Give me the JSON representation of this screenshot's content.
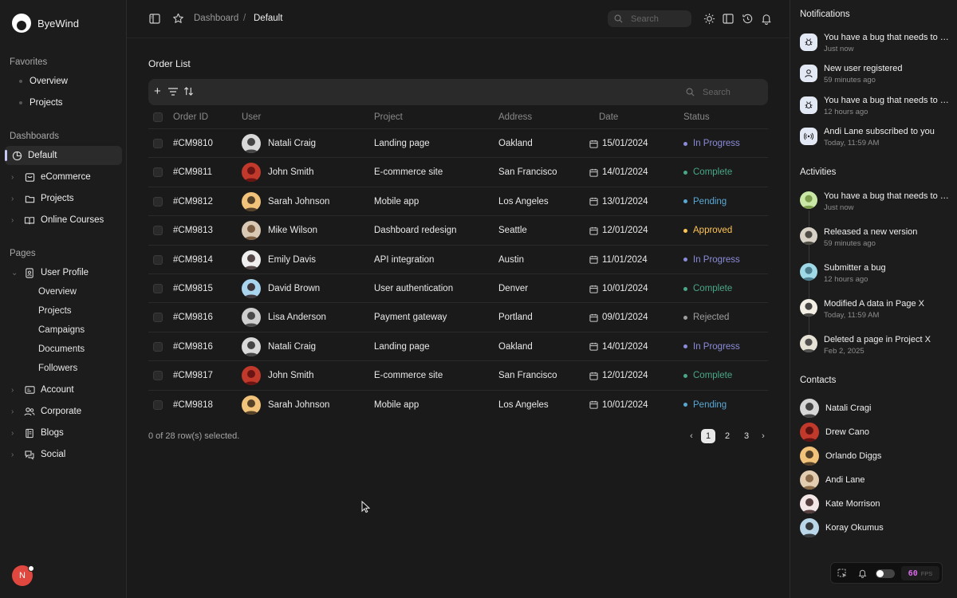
{
  "brand": {
    "name": "ByeWind"
  },
  "sidebar": {
    "favorites_title": "Favorites",
    "favorites": [
      "Overview",
      "Projects"
    ],
    "dashboards_title": "Dashboards",
    "dashboards": [
      {
        "label": "Default",
        "icon": "pie-chart-icon"
      },
      {
        "label": "eCommerce",
        "icon": "shopping-bag-icon"
      },
      {
        "label": "Projects",
        "icon": "folder-icon"
      },
      {
        "label": "Online Courses",
        "icon": "book-icon"
      }
    ],
    "pages_title": "Pages",
    "user_profile": {
      "label": "User Profile",
      "children": [
        "Overview",
        "Projects",
        "Campaigns",
        "Documents",
        "Followers"
      ]
    },
    "pages": [
      {
        "label": "Account",
        "icon": "id-card-icon"
      },
      {
        "label": "Corporate",
        "icon": "users-icon"
      },
      {
        "label": "Blogs",
        "icon": "notebook-icon"
      },
      {
        "label": "Social",
        "icon": "chat-icon"
      }
    ],
    "user_initial": "N"
  },
  "topbar": {
    "crumb_root": "Dashboard",
    "crumb_sep": "/",
    "crumb_current": "Default",
    "search_placeholder": "Search"
  },
  "orders": {
    "title": "Order List",
    "search_placeholder": "Search",
    "columns": [
      "Order ID",
      "User",
      "Project",
      "Address",
      "Date",
      "Status"
    ],
    "rows": [
      {
        "id": "#CM9810",
        "user": "Natali Craig",
        "project": "Landing page",
        "address": "Oakland",
        "date": "15/01/2024",
        "status": "In Progress"
      },
      {
        "id": "#CM9811",
        "user": "John Smith",
        "project": "E-commerce site",
        "address": "San Francisco",
        "date": "14/01/2024",
        "status": "Complete"
      },
      {
        "id": "#CM9812",
        "user": "Sarah Johnson",
        "project": "Mobile app",
        "address": "Los Angeles",
        "date": "13/01/2024",
        "status": "Pending"
      },
      {
        "id": "#CM9813",
        "user": "Mike Wilson",
        "project": "Dashboard redesign",
        "address": "Seattle",
        "date": "12/01/2024",
        "status": "Approved"
      },
      {
        "id": "#CM9814",
        "user": "Emily Davis",
        "project": "API integration",
        "address": "Austin",
        "date": "11/01/2024",
        "status": "In Progress"
      },
      {
        "id": "#CM9815",
        "user": "David Brown",
        "project": "User authentication",
        "address": "Denver",
        "date": "10/01/2024",
        "status": "Complete"
      },
      {
        "id": "#CM9816",
        "user": "Lisa Anderson",
        "project": "Payment gateway",
        "address": "Portland",
        "date": "09/01/2024",
        "status": "Rejected"
      },
      {
        "id": "#CM9816",
        "user": "Natali Craig",
        "project": "Landing page",
        "address": "Oakland",
        "date": "14/01/2024",
        "status": "In Progress"
      },
      {
        "id": "#CM9817",
        "user": "John Smith",
        "project": "E-commerce site",
        "address": "San Francisco",
        "date": "12/01/2024",
        "status": "Complete"
      },
      {
        "id": "#CM9818",
        "user": "Sarah Johnson",
        "project": "Mobile app",
        "address": "Los Angeles",
        "date": "10/01/2024",
        "status": "Pending"
      }
    ],
    "selection_text": "0 of 28 row(s) selected.",
    "pages": [
      "1",
      "2",
      "3"
    ],
    "status_colors": {
      "In Progress": "#8a8cd9",
      "Complete": "#4aa785",
      "Pending": "#59a8d4",
      "Approved": "#ffc555",
      "Rejected": "#9e9e9e"
    }
  },
  "right": {
    "notifications_title": "Notifications",
    "notifications": [
      {
        "text": "You have a bug that needs to be fixed.",
        "time": "Just now",
        "icon": "bug-icon"
      },
      {
        "text": "New user registered",
        "time": "59 minutes ago",
        "icon": "user-icon"
      },
      {
        "text": "You have a bug that needs to be fixed.",
        "time": "12 hours ago",
        "icon": "bug-icon"
      },
      {
        "text": "Andi Lane subscribed to you",
        "time": "Today, 11:59 AM",
        "icon": "broadcast-icon"
      }
    ],
    "activities_title": "Activities",
    "activities": [
      {
        "text": "You have a bug that needs to be fixed.",
        "time": "Just now"
      },
      {
        "text": "Released a new version",
        "time": "59 minutes ago"
      },
      {
        "text": "Submitter a bug",
        "time": "12 hours ago"
      },
      {
        "text": "Modified A data in Page X",
        "time": "Today, 11:59 AM"
      },
      {
        "text": "Deleted a page in Project X",
        "time": "Feb 2, 2025"
      }
    ],
    "contacts_title": "Contacts",
    "contacts": [
      "Natali Cragi",
      "Drew Cano",
      "Orlando Diggs",
      "Andi Lane",
      "Kate Morrison",
      "Koray Okumus"
    ]
  },
  "devbar": {
    "fps_value": "60",
    "fps_label": "FPS"
  }
}
